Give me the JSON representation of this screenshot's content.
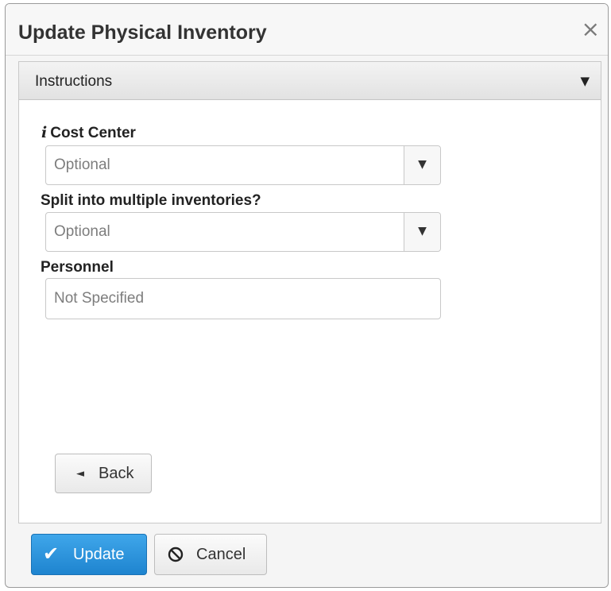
{
  "dialog": {
    "title": "Update Physical Inventory",
    "close_glyph": "×"
  },
  "instructions": {
    "label": "Instructions",
    "caret": "▼"
  },
  "fields": {
    "cost_center": {
      "info_icon": "i",
      "label": "Cost Center",
      "value": "Optional",
      "dropdown_glyph": "▼"
    },
    "split": {
      "label": "Split into multiple inventories?",
      "value": "Optional",
      "dropdown_glyph": "▼"
    },
    "personnel": {
      "label": "Personnel",
      "value": "Not Specified"
    }
  },
  "buttons": {
    "back": {
      "label": "Back",
      "icon": "◄"
    },
    "update": {
      "label": "Update",
      "icon": "✔"
    },
    "cancel": {
      "label": "Cancel",
      "icon": "ban-icon"
    }
  },
  "colors": {
    "primary": "#2b93dc",
    "placeholder": "#7d7d7d"
  }
}
